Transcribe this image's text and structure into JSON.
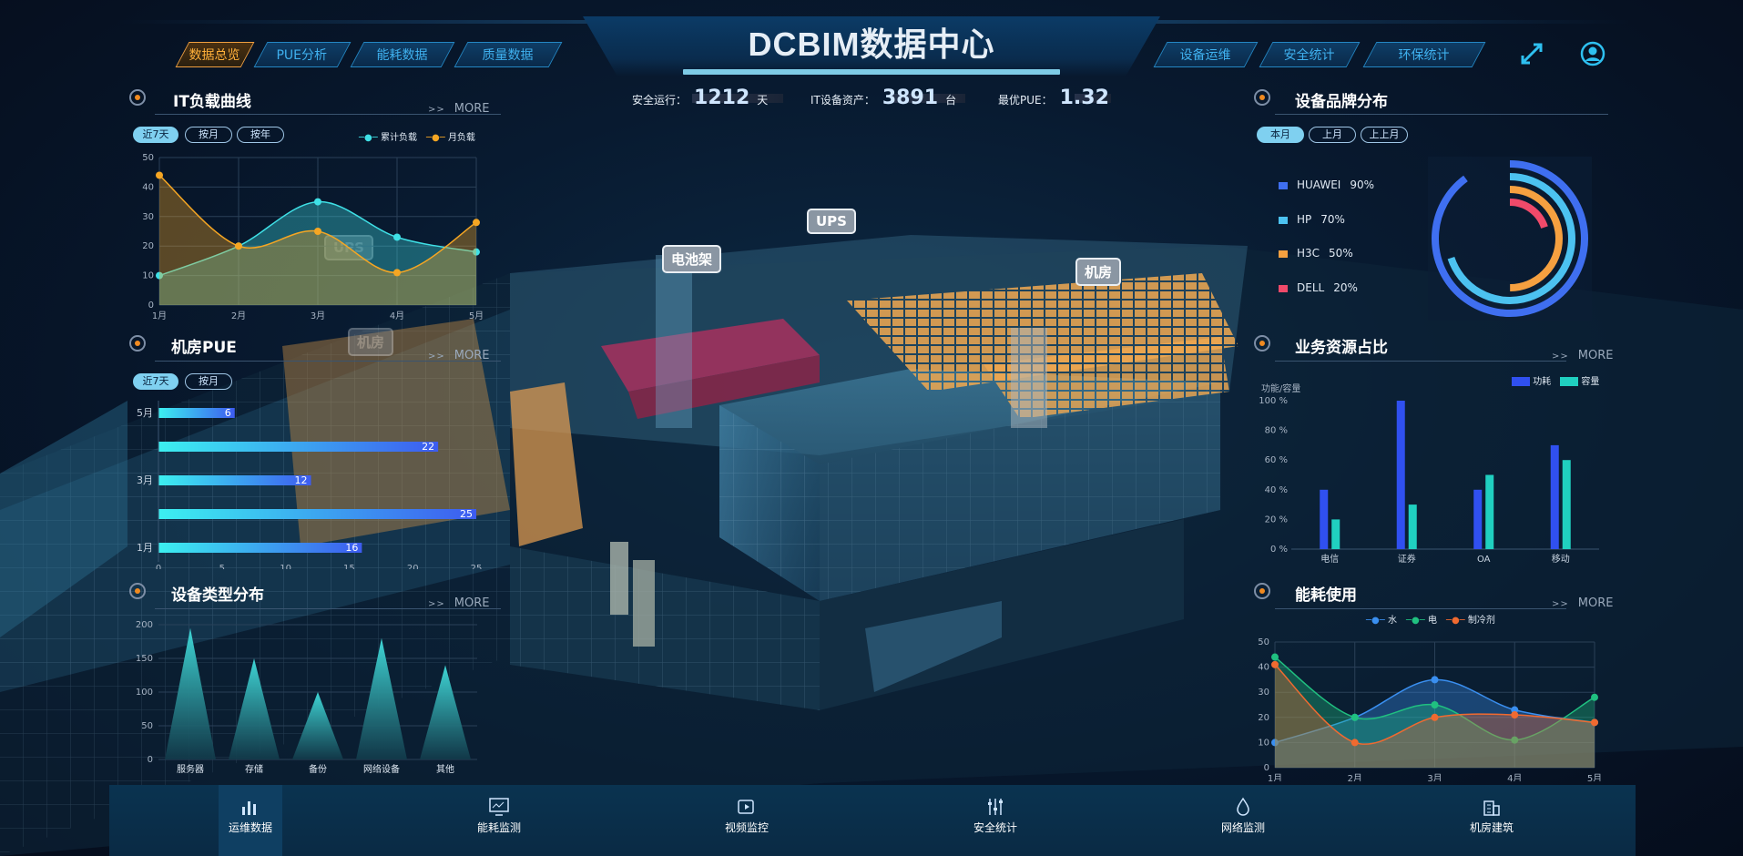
{
  "header": {
    "title": "DCBIM数据中心",
    "left_tabs": [
      {
        "label": "数据总览",
        "active": true
      },
      {
        "label": "PUE分析"
      },
      {
        "label": "能耗数据"
      },
      {
        "label": "质量数据"
      }
    ],
    "right_tabs": [
      {
        "label": "设备运维"
      },
      {
        "label": "安全统计"
      },
      {
        "label": "环保统计"
      }
    ],
    "fullscreen_icon": "expand-icon",
    "user_icon": "user-icon"
  },
  "stats": {
    "safe_label": "安全运行：",
    "safe_value": "1212",
    "safe_unit": "天",
    "assets_label": "IT设备资产：",
    "assets_value": "3891",
    "assets_unit": "台",
    "pue_label": "最优PUE：",
    "pue_value": "1.32"
  },
  "scene_labels": {
    "ups": "UPS",
    "battery": "电池架",
    "room": "机房",
    "ghost_ups": "UPS",
    "ghost_room": "机房"
  },
  "panels": {
    "it_load": {
      "title": "IT负载曲线",
      "more": "MORE",
      "more_arrows": ">>",
      "filters": [
        "近7天",
        "按月",
        "按年"
      ],
      "active_filter": 0,
      "legend": [
        "累计负载",
        "月负载"
      ]
    },
    "pue": {
      "title": "机房PUE",
      "more": "MORE",
      "more_arrows": ">>",
      "filters": [
        "近7天",
        "按月"
      ],
      "active_filter": 0
    },
    "device_type": {
      "title": "设备类型分布",
      "more": "MORE",
      "more_arrows": ">>"
    },
    "brand": {
      "title": "设备品牌分布",
      "filters": [
        "本月",
        "上月",
        "上上月"
      ],
      "active_filter": 0
    },
    "business": {
      "title": "业务资源占比",
      "more": "MORE",
      "more_arrows": ">>",
      "ylabel": "功能/容量",
      "legend": [
        "功耗",
        "容量"
      ]
    },
    "energy": {
      "title": "能耗使用",
      "more": "MORE",
      "more_arrows": ">>",
      "legend": [
        "水",
        "电",
        "制冷剂"
      ]
    }
  },
  "footer": {
    "items": [
      {
        "label": "运维数据",
        "icon": "bar-chart-icon",
        "active": true
      },
      {
        "label": "能耗监测",
        "icon": "monitor-icon"
      },
      {
        "label": "视频监控",
        "icon": "video-icon"
      },
      {
        "label": "安全统计",
        "icon": "sliders-icon"
      },
      {
        "label": "网络监测",
        "icon": "drop-icon"
      },
      {
        "label": "机房建筑",
        "icon": "building-icon"
      }
    ]
  },
  "chart_data": [
    {
      "id": "it_load",
      "type": "line",
      "x": [
        "1月",
        "2月",
        "3月",
        "4月",
        "5月"
      ],
      "ylim": [
        0,
        50
      ],
      "yticks": [
        0,
        10,
        20,
        30,
        40,
        50
      ],
      "series": [
        {
          "name": "累计负载",
          "color": "#3fe0e6",
          "values": [
            10,
            20,
            35,
            23,
            18
          ]
        },
        {
          "name": "月负载",
          "color": "#f5a623",
          "values": [
            44,
            20,
            25,
            11,
            28
          ]
        }
      ]
    },
    {
      "id": "pue",
      "type": "bar",
      "orientation": "horizontal",
      "categories": [
        "1月",
        "",
        "3月",
        "",
        "5月"
      ],
      "values": [
        16,
        25,
        12,
        22,
        6
      ],
      "xlim": [
        0,
        25
      ],
      "xticks": [
        0,
        5,
        10,
        15,
        20,
        25
      ]
    },
    {
      "id": "device_type",
      "type": "bar",
      "categories": [
        "服务器",
        "存储",
        "备份",
        "网络设备",
        "其他"
      ],
      "values": [
        195,
        150,
        100,
        180,
        140
      ],
      "ylim": [
        0,
        200
      ],
      "yticks": [
        0,
        50,
        100,
        150,
        200
      ]
    },
    {
      "id": "brand",
      "type": "pie",
      "categories": [
        "HUAWEI",
        "HP",
        "H3C",
        "DELL"
      ],
      "values": [
        90,
        70,
        50,
        20
      ],
      "value_labels": [
        "90%",
        "70%",
        "50%",
        "20%"
      ],
      "colors": [
        "#3f6ff0",
        "#4cc2f0",
        "#f5a040",
        "#f04a6a"
      ]
    },
    {
      "id": "business",
      "type": "bar",
      "categories": [
        "电信",
        "证券",
        "OA",
        "移动"
      ],
      "ylim": [
        0,
        100
      ],
      "ytick_labels": [
        "0 %",
        "20 %",
        "40 %",
        "60 %",
        "80 %",
        "100 %"
      ],
      "series": [
        {
          "name": "功耗",
          "color": "#3050f0",
          "values": [
            40,
            100,
            40,
            70
          ]
        },
        {
          "name": "容量",
          "color": "#20d0c0",
          "values": [
            20,
            30,
            50,
            60
          ]
        }
      ]
    },
    {
      "id": "energy",
      "type": "line",
      "x": [
        "1月",
        "2月",
        "3月",
        "4月",
        "5月"
      ],
      "ylim": [
        0,
        50
      ],
      "yticks": [
        0,
        10,
        20,
        30,
        40,
        50
      ],
      "series": [
        {
          "name": "水",
          "color": "#3a8ff0",
          "values": [
            10,
            20,
            35,
            23,
            18
          ]
        },
        {
          "name": "电",
          "color": "#20c080",
          "values": [
            44,
            20,
            25,
            11,
            28
          ]
        },
        {
          "name": "制冷剂",
          "color": "#f06a30",
          "values": [
            41,
            10,
            20,
            21,
            18
          ]
        }
      ]
    }
  ]
}
